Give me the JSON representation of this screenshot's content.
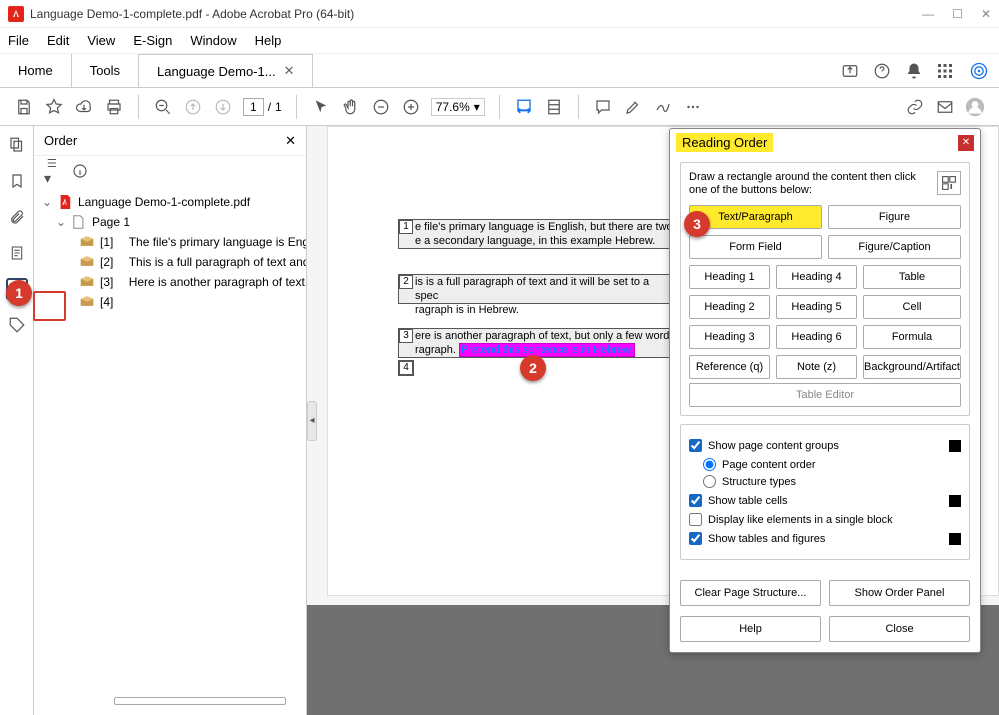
{
  "window": {
    "title": "Language Demo-1-complete.pdf - Adobe Acrobat Pro (64-bit)"
  },
  "menu": {
    "items": [
      "File",
      "Edit",
      "View",
      "E-Sign",
      "Window",
      "Help"
    ]
  },
  "tabs": {
    "home": "Home",
    "tools": "Tools",
    "doc": "Language Demo-1..."
  },
  "toolbar": {
    "page_current": "1",
    "page_sep": "/",
    "page_total": "1",
    "zoom": "77.6%"
  },
  "order_panel": {
    "title": "Order",
    "root": "Language Demo-1-complete.pdf",
    "page": "Page 1",
    "items": [
      {
        "idx": "[1]",
        "text": "The file's primary language is Engli"
      },
      {
        "idx": "[2]",
        "text": "This is a full paragraph of text and"
      },
      {
        "idx": "[3]",
        "text": "Here is another paragraph of text,"
      },
      {
        "idx": "[4]",
        "text": ""
      }
    ]
  },
  "page_content": {
    "p1": {
      "num": "1",
      "text_a": "e file's primary language is English, but there are two",
      "text_b": "e a secondary language, in this example Hebrew."
    },
    "p2": {
      "num": "2",
      "text_a": "is is a full paragraph of text and it will be set to a spec",
      "text_b": "ragraph is in Hebrew."
    },
    "p3": {
      "num": "3",
      "text_a": "ere is another paragraph of text, but only a few words",
      "text_b_pre": "ragraph. ",
      "text_b_hl": "Pretend this sentence is in Hebrew."
    },
    "p4": {
      "num": "4"
    }
  },
  "reading_order": {
    "title": "Reading Order",
    "instr": "Draw a rectangle around the content then click one of the buttons below:",
    "buttons": {
      "text": "Text/Paragraph",
      "figure": "Figure",
      "formfield": "Form Field",
      "figcap": "Figure/Caption",
      "h1": "Heading 1",
      "h4": "Heading 4",
      "table": "Table",
      "h2": "Heading 2",
      "h5": "Heading 5",
      "cell": "Cell",
      "h3": "Heading 3",
      "h6": "Heading 6",
      "formula": "Formula",
      "ref": "Reference (q)",
      "note": "Note (z)",
      "bg": "Background/Artifact",
      "table_editor": "Table Editor"
    },
    "opts": {
      "show_groups": "Show page content groups",
      "page_order": "Page content order",
      "struct_types": "Structure types",
      "show_cells": "Show table cells",
      "display_like": "Display like elements in a single block",
      "show_tables_figs": "Show tables and figures"
    },
    "foot": {
      "clear": "Clear Page Structure...",
      "show_order": "Show Order Panel",
      "help": "Help",
      "close": "Close"
    }
  },
  "callouts": {
    "c1": "1",
    "c2": "2",
    "c3": "3"
  }
}
